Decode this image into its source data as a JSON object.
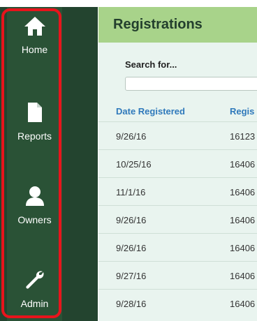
{
  "sidebar": {
    "items": [
      {
        "label": "Home",
        "icon": "home-icon"
      },
      {
        "label": "Reports",
        "icon": "document-icon"
      },
      {
        "label": "Owners",
        "icon": "person-icon"
      },
      {
        "label": "Admin",
        "icon": "wrench-icon"
      }
    ]
  },
  "colors": {
    "sidebar": "#23442f",
    "header": "#a8d38a",
    "highlight": "#e8141c",
    "link": "#2f79bb",
    "content_bg": "#e9f4ef"
  },
  "main": {
    "title": "Registrations",
    "search": {
      "label": "Search for...",
      "value": "",
      "placeholder": ""
    },
    "table": {
      "columns": [
        "Date Registered",
        "Regis"
      ],
      "rows": [
        [
          "9/26/16",
          "16123"
        ],
        [
          "10/25/16",
          "16406"
        ],
        [
          "11/1/16",
          "16406"
        ],
        [
          "9/26/16",
          "16406"
        ],
        [
          "9/26/16",
          "16406"
        ],
        [
          "9/27/16",
          "16406"
        ],
        [
          "9/28/16",
          "16406"
        ]
      ]
    }
  }
}
